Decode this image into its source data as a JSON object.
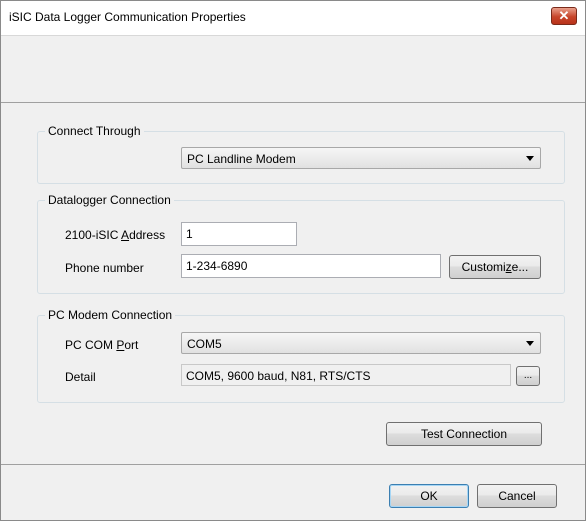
{
  "window": {
    "title": "iSIC Data Logger Communication Properties",
    "close_glyph": "✕"
  },
  "connect_through": {
    "group_label": "Connect Through",
    "selected": "PC Landline Modem"
  },
  "datalogger_connection": {
    "group_label": "Datalogger Connection",
    "address_label_pre": "2100-iSIC ",
    "address_label_key": "A",
    "address_label_post": "ddress",
    "address_value": "1",
    "phone_label": "Phone number",
    "phone_value": "1-234-6890",
    "customize_pre": "Customi",
    "customize_key": "z",
    "customize_post": "e..."
  },
  "pc_modem_connection": {
    "group_label": "PC Modem Connection",
    "com_port_label_pre": "PC COM ",
    "com_port_label_key": "P",
    "com_port_label_post": "ort",
    "com_port_selected": "COM5",
    "detail_label": "Detail",
    "detail_value": "COM5, 9600 baud, N81, RTS/CTS",
    "detail_button": "..."
  },
  "buttons": {
    "test_connection": "Test Connection",
    "ok": "OK",
    "cancel": "Cancel"
  }
}
